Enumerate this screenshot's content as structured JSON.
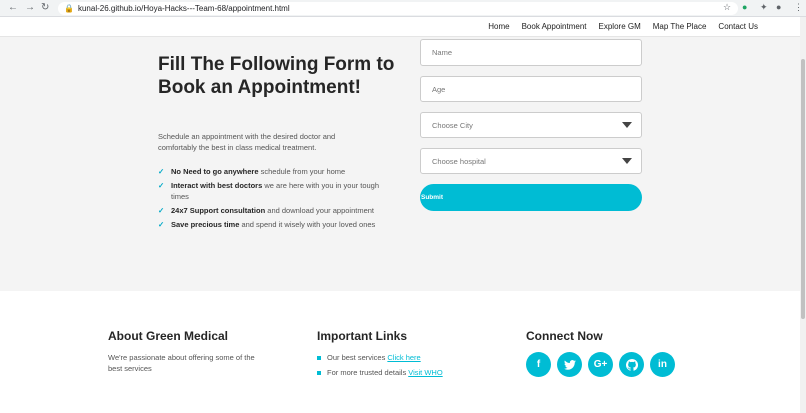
{
  "browser": {
    "url": "kunal-26.github.io/Hoya-Hacks---Team-68/appointment.html"
  },
  "nav": {
    "links": [
      "Home",
      "Book Appointment",
      "Explore GM",
      "Map The Place",
      "Contact Us"
    ]
  },
  "hero": {
    "title": "Fill The Following Form to Book an Appointment!",
    "subtitle": "Schedule an appointment with the desired doctor and comfortably the best in class medical treatment.",
    "features": [
      {
        "bold": "No Need to go anywhere",
        "rest": " schedule from your home"
      },
      {
        "bold": "Interact with best doctors",
        "rest": " we are here with you in your tough times"
      },
      {
        "bold": "24x7 Support consultation",
        "rest": " and download your appointment"
      },
      {
        "bold": "Save precious time",
        "rest": " and spend it wisely with your loved ones"
      }
    ]
  },
  "form": {
    "name_placeholder": "Name",
    "age_placeholder": "Age",
    "city_selected": "Choose City",
    "hospital_selected": "Choose hospital",
    "submit_label": "Submit"
  },
  "footer": {
    "about": {
      "title": "About Green Medical",
      "text": "We're passionate about offering some of the best services"
    },
    "links": {
      "title": "Important Links",
      "items": [
        {
          "text": "Our best services",
          "link": "Click here"
        },
        {
          "text": "For more trusted details",
          "link": "Visit WHO"
        }
      ]
    },
    "connect": {
      "title": "Connect Now",
      "icons": [
        "facebook-icon",
        "twitter-icon",
        "google-plus-icon",
        "github-icon",
        "linkedin-icon"
      ]
    }
  },
  "colors": {
    "accent": "#00bcd4",
    "check": "#00a9c7"
  }
}
